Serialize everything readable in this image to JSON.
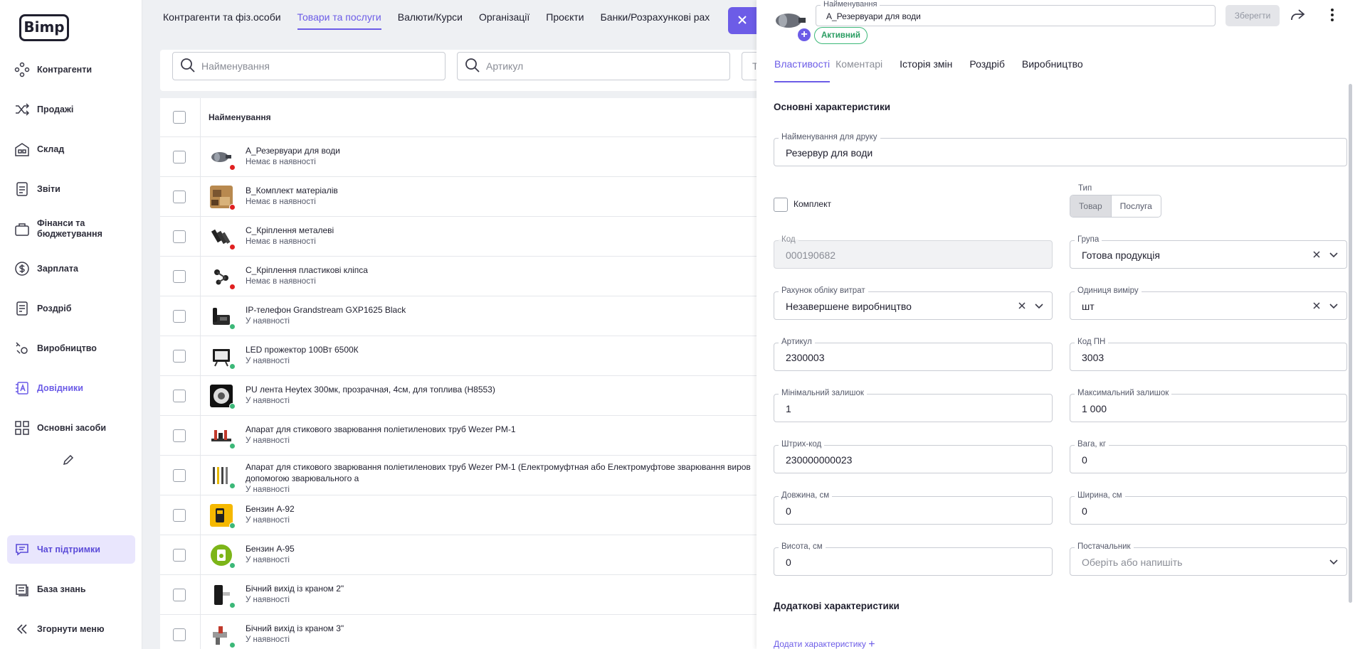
{
  "logo": "Bimp",
  "sidebar": {
    "items": [
      {
        "label": "Контрагенти",
        "icon": "contractors-icon"
      },
      {
        "label": "Продажі",
        "icon": "shuffle-icon"
      },
      {
        "label": "Склад",
        "icon": "warehouse-icon"
      },
      {
        "label": "Звіти",
        "icon": "report-icon"
      },
      {
        "label": "Фінанси та бюджетування",
        "icon": "briefcase-icon"
      },
      {
        "label": "Зарплата",
        "icon": "dollar-icon"
      },
      {
        "label": "Роздріб",
        "icon": "receipt-icon"
      },
      {
        "label": "Виробництво",
        "icon": "production-icon"
      },
      {
        "label": "Довідники",
        "icon": "dictionary-icon"
      },
      {
        "label": "Основні засоби",
        "icon": "grid-icon"
      }
    ],
    "bottom": [
      {
        "label": "Чат підтримки",
        "icon": "chat-icon"
      },
      {
        "label": "База знань",
        "icon": "book-icon"
      },
      {
        "label": "Згорнути меню",
        "icon": "collapse-icon"
      }
    ]
  },
  "top_tabs": [
    "Контрагенти та фіз.особи",
    "Товари та послуги",
    "Валюти/Курси",
    "Організації",
    "Проєкти",
    "Банки/Розрахункові рах"
  ],
  "filters": {
    "name_placeholder": "Найменування",
    "sku_placeholder": "Артикул",
    "third_placeholder": "Т"
  },
  "table": {
    "header": "Найменування",
    "rows": [
      {
        "name": "А_Резервуари для води",
        "status": "Немає в наявності",
        "in_stock": false
      },
      {
        "name": "В_Комплект матеріалів",
        "status": "Немає в наявності",
        "in_stock": false
      },
      {
        "name": "С_Кріплення металеві",
        "status": "Немає в наявності",
        "in_stock": false
      },
      {
        "name": "С_Кріплення пластикові кліпса",
        "status": "Немає в наявності",
        "in_stock": false
      },
      {
        "name": "IP-телефон Grandstream GXP1625 Black",
        "status": "У наявності",
        "in_stock": true
      },
      {
        "name": "LED прожектор 100Вт 6500К",
        "status": "У наявності",
        "in_stock": true
      },
      {
        "name": "PU лента Heytex 300мк, прозрачная, 4см, для топлива (H8553)",
        "status": "У наявності",
        "in_stock": true
      },
      {
        "name": "Апарат для стикового зварювання поліетиленових труб Wezer PM-1",
        "status": "У наявності",
        "in_stock": true
      },
      {
        "name": "Апарат для стикового зварювання поліетиленових труб Wezer PM-1 (Електромуфтная або Електромуфтове зварювання виров допомогою зварювального а",
        "status": "У наявності",
        "in_stock": true
      },
      {
        "name": "Бензин А-92",
        "status": "У наявності",
        "in_stock": true
      },
      {
        "name": "Бензин А-95",
        "status": "У наявності",
        "in_stock": true
      },
      {
        "name": "Бічний вихід із краном 2\"",
        "status": "У наявності",
        "in_stock": true
      },
      {
        "name": "Бічний вихід із краном 3\"",
        "status": "У наявності",
        "in_stock": true
      }
    ]
  },
  "panel": {
    "name_label": "Найменування",
    "name_value": "А_Резервуари для води",
    "status_badge": "Активний",
    "save_label": "Зберегти",
    "tabs": [
      "Властивості",
      "Коментарі",
      "Історія змін",
      "Роздріб",
      "Виробництво"
    ],
    "section_main": "Основні характеристики",
    "print_name": {
      "label": "Найменування для друку",
      "value": "Резервур для води"
    },
    "kit_label": "Комплект",
    "type_label": "Тип",
    "type_options": [
      "Товар",
      "Послуга"
    ],
    "type_selected": "Товар",
    "code": {
      "label": "Код",
      "value": "000190682"
    },
    "group": {
      "label": "Група",
      "value": "Готова продукція"
    },
    "cost_account": {
      "label": "Рахунок обліку витрат",
      "value": "Незавершене виробництво"
    },
    "unit": {
      "label": "Одиниця виміру",
      "value": "шт"
    },
    "sku": {
      "label": "Артикул",
      "value": "2300003"
    },
    "pn_code": {
      "label": "Код ПН",
      "value": "3003"
    },
    "min_stock": {
      "label": "Мінімальний залишок",
      "value": "1"
    },
    "max_stock": {
      "label": "Максимальний залишок",
      "value": "1 000"
    },
    "barcode": {
      "label": "Штрих-код",
      "value": "230000000023"
    },
    "weight": {
      "label": "Вага, кг",
      "value": "0"
    },
    "length": {
      "label": "Довжина, см",
      "value": "0"
    },
    "width": {
      "label": "Ширина, см",
      "value": "0"
    },
    "height": {
      "label": "Висота, см",
      "value": "0"
    },
    "supplier": {
      "label": "Постачальник",
      "placeholder": "Оберіть або напишіть"
    },
    "section_extra": "Додаткові характеристики",
    "add_char": "Додати характеристику"
  },
  "colors": {
    "accent": "#6c5ce7",
    "in_stock": "#3cb878",
    "out_of_stock": "#e02020"
  }
}
